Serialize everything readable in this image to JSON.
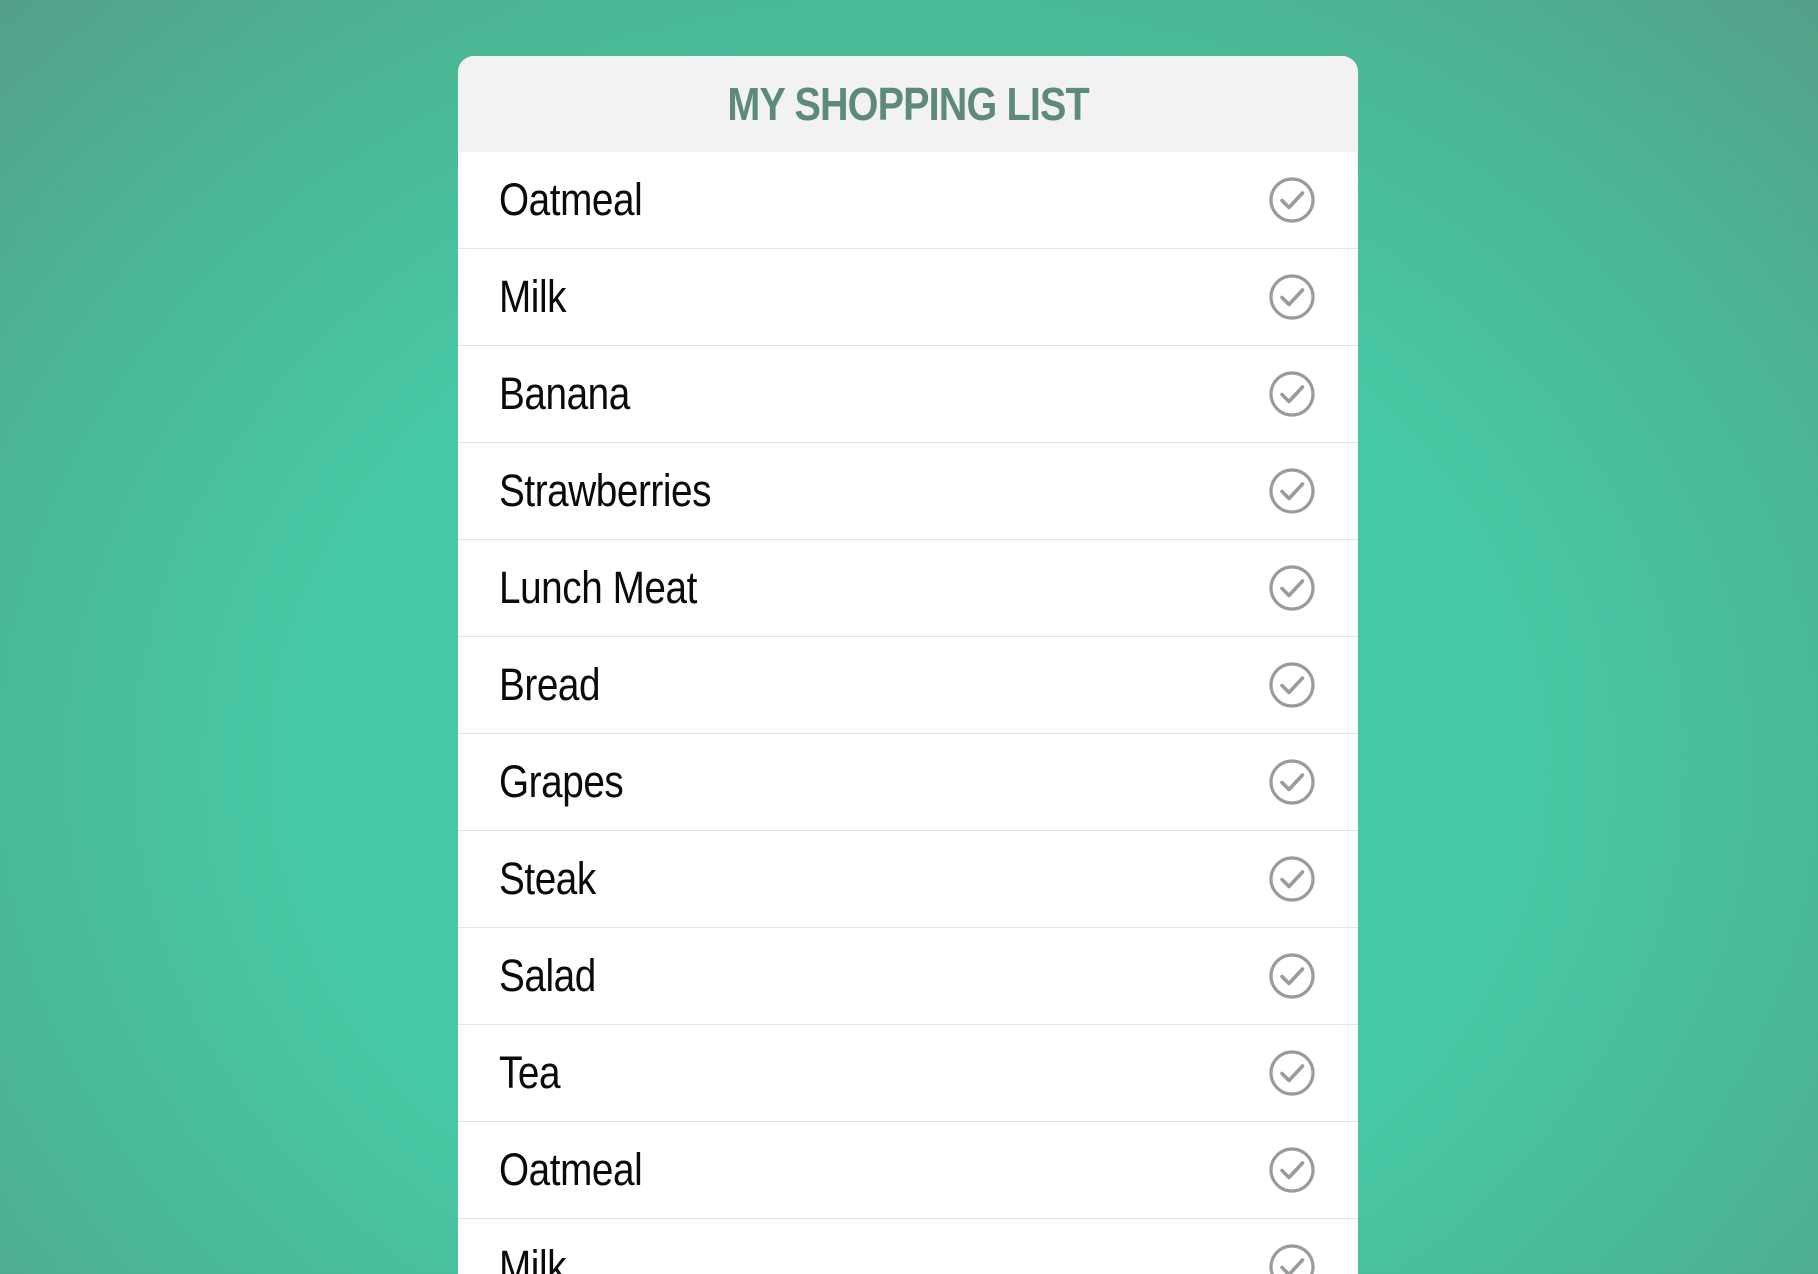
{
  "header": {
    "title": "MY SHOPPING LIST"
  },
  "items": [
    {
      "label": "Oatmeal"
    },
    {
      "label": "Milk"
    },
    {
      "label": "Banana"
    },
    {
      "label": "Strawberries"
    },
    {
      "label": "Lunch Meat"
    },
    {
      "label": "Bread"
    },
    {
      "label": "Grapes"
    },
    {
      "label": "Steak"
    },
    {
      "label": "Salad"
    },
    {
      "label": "Tea"
    },
    {
      "label": "Oatmeal"
    },
    {
      "label": "Milk"
    }
  ],
  "icons": {
    "item_action": "check-circle-icon"
  },
  "colors": {
    "title": "#5d8a7c",
    "header_bg": "#f2f2f2",
    "icon": "#9b9b9b",
    "background_center": "#46c9a5",
    "background_edge": "#569a86"
  }
}
